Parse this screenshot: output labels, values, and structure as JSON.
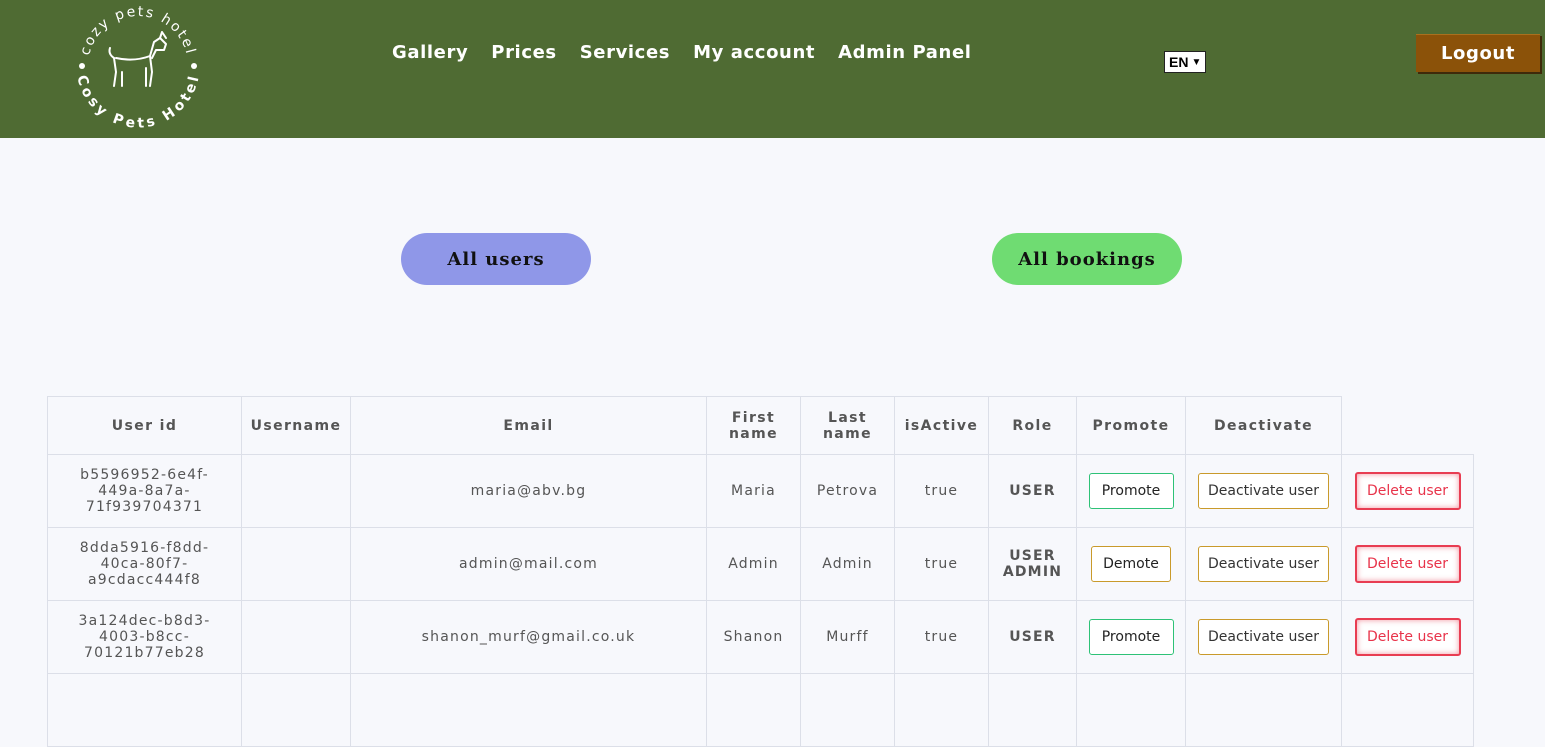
{
  "header": {
    "logo_text_top": "cozy pets hotel",
    "logo_text_bottom": "Cosy Pets Hotel",
    "nav": [
      "Gallery",
      "Prices",
      "Services",
      "My account",
      "Admin Panel"
    ],
    "language": "EN",
    "logout_label": "Logout",
    "colors": {
      "header_bg": "#4f6b33",
      "logout_bg": "#8b5209"
    }
  },
  "tabs": {
    "all_users": "All users",
    "all_bookings": "All bookings"
  },
  "table": {
    "headers": {
      "user_id": "User id",
      "username": "Username",
      "email": "Email",
      "first_name": "First name",
      "last_name": "Last name",
      "is_active": "isActive",
      "role": "Role",
      "promote": "Promote",
      "deactivate": "Deactivate"
    },
    "rows": [
      {
        "user_id": "b5596952-6e4f-449a-8a7a-71f939704371",
        "user_id_lines": [
          "b5596952-6e4f-",
          "449a-8a7a-",
          "71f939704371"
        ],
        "username": "",
        "email": "maria@abv.bg",
        "first_name": "Maria",
        "last_name": "Petrova",
        "is_active": "true",
        "roles": [
          "USER"
        ],
        "promote_label": "Promote",
        "deactivate_label": "Deactivate user",
        "delete_label": "Delete user"
      },
      {
        "user_id": "8dda5916-f8dd-40ca-80f7-a9cdacc444f8",
        "user_id_lines": [
          "8dda5916-f8dd-",
          "40ca-80f7-",
          "a9cdacc444f8"
        ],
        "username": "",
        "email": "admin@mail.com",
        "first_name": "Admin",
        "last_name": "Admin",
        "is_active": "true",
        "roles": [
          "USER",
          "ADMIN"
        ],
        "promote_label": "Demote",
        "deactivate_label": "Deactivate user",
        "delete_label": "Delete user"
      },
      {
        "user_id": "3a124dec-b8d3-4003-b8cc-70121b77eb28",
        "user_id_lines": [
          "3a124dec-b8d3-",
          "4003-b8cc-",
          "70121b77eb28"
        ],
        "username": "",
        "email": "shanon_murf@gmail.co.uk",
        "first_name": "Shanon",
        "last_name": "Murff",
        "is_active": "true",
        "roles": [
          "USER"
        ],
        "promote_label": "Promote",
        "deactivate_label": "Deactivate user",
        "delete_label": "Delete user"
      }
    ]
  }
}
